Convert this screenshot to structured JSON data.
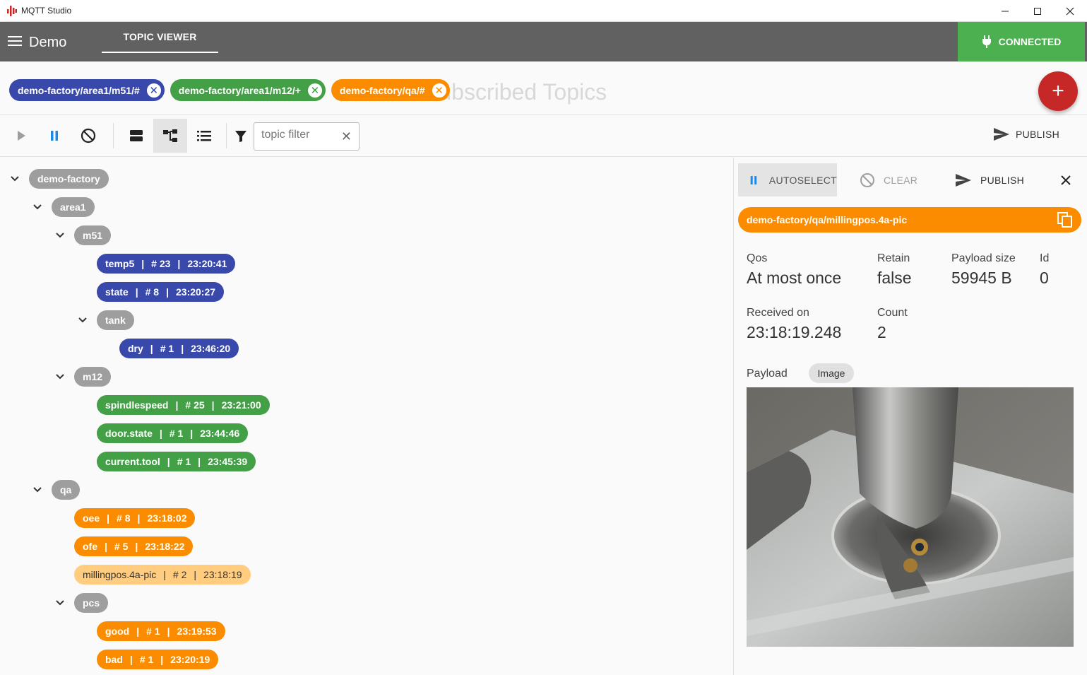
{
  "window": {
    "title": "MQTT Studio",
    "minimize": "—",
    "maximize": "☐",
    "close": "✕"
  },
  "appbar": {
    "connection_name": "Demo",
    "tab_label": "TOPIC VIEWER",
    "status_label": "CONNECTED"
  },
  "subscriptions": {
    "placeholder": "Subscribed Topics",
    "chips": [
      {
        "label": "demo-factory/area1/m51/#",
        "color": "#3949ab"
      },
      {
        "label": "demo-factory/area1/m12/+",
        "color": "#43a047"
      },
      {
        "label": "demo-factory/qa/#",
        "color": "#fb8c00"
      }
    ],
    "add_label": "+"
  },
  "toolbar": {
    "filter_placeholder": "topic filter",
    "publish_label": "PUBLISH"
  },
  "tree": {
    "nodes": {
      "demo_factory": "demo-factory",
      "area1": "area1",
      "m51": "m51",
      "temp5": {
        "name": "temp5",
        "count": "# 23",
        "time": "23:20:41"
      },
      "state": {
        "name": "state",
        "count": "# 8",
        "time": "23:20:27"
      },
      "tank": "tank",
      "dry": {
        "name": "dry",
        "count": "# 1",
        "time": "23:46:20"
      },
      "m12": "m12",
      "spindlespeed": {
        "name": "spindlespeed",
        "count": "# 25",
        "time": "23:21:00"
      },
      "door_state": {
        "name": "door.state",
        "count": "# 1",
        "time": "23:44:46"
      },
      "current_tool": {
        "name": "current.tool",
        "count": "# 1",
        "time": "23:45:39"
      },
      "qa": "qa",
      "oee": {
        "name": "oee",
        "count": "# 8",
        "time": "23:18:02"
      },
      "ofe": {
        "name": "ofe",
        "count": "# 5",
        "time": "23:18:22"
      },
      "millingpos": {
        "name": "millingpos.4a-pic",
        "count": "# 2",
        "time": "23:18:19"
      },
      "pcs": "pcs",
      "good": {
        "name": "good",
        "count": "# 1",
        "time": "23:19:53"
      },
      "bad": {
        "name": "bad",
        "count": "# 1",
        "time": "23:20:19"
      }
    },
    "separator": "|"
  },
  "detail": {
    "autoselect_label": "AUTOSELECT",
    "clear_label": "CLEAR",
    "publish_label": "PUBLISH",
    "topic": "demo-factory/qa/millingpos.4a-pic",
    "qos_label": "Qos",
    "qos_value": "At most once",
    "retain_label": "Retain",
    "retain_value": "false",
    "size_label": "Payload size",
    "size_value": "59945 B",
    "id_label": "Id",
    "id_value": "0",
    "received_label": "Received on",
    "received_value": "23:18:19.248",
    "count_label": "Count",
    "count_value": "2",
    "payload_label": "Payload",
    "payload_type": "Image"
  },
  "colors": {
    "appbar": "#616161",
    "connected": "#4caf50",
    "fab": "#c62828",
    "blue": "#3949ab",
    "green": "#43a047",
    "orange": "#fb8c00",
    "selected": "#ffcc80"
  }
}
